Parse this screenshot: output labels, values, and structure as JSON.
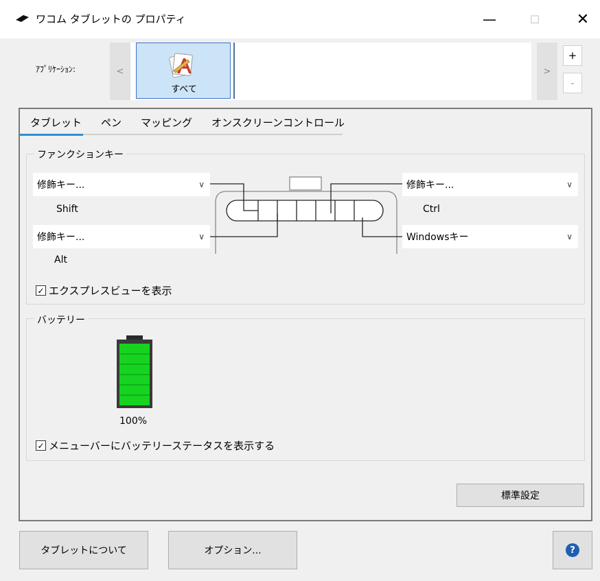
{
  "window": {
    "title": "ワコム タブレットの プロパティ",
    "minimize_glyph": "—",
    "maximize_glyph": "☐",
    "close_glyph": "✕"
  },
  "applications": {
    "label": "ｱﾌﾟﾘｹｰｼｮﾝ:",
    "prev_glyph": "<",
    "next_glyph": ">",
    "items": [
      {
        "label": "すべて",
        "icon": "all-applications-icon",
        "selected": true
      }
    ],
    "add_glyph": "+",
    "remove_glyph": "-"
  },
  "tabs": [
    {
      "label": "タブレット",
      "active": true
    },
    {
      "label": "ペン",
      "active": false
    },
    {
      "label": "マッピング",
      "active": false
    },
    {
      "label": "オンスクリーンコントロール",
      "active": false
    }
  ],
  "function_keys": {
    "title": "ファンクションキー",
    "left_top": {
      "value": "修飾キー...",
      "caption": "Shift"
    },
    "left_bottom": {
      "value": "修飾キー...",
      "caption": "Alt"
    },
    "right_top": {
      "value": "修飾キー...",
      "caption": "Ctrl"
    },
    "right_bottom": {
      "value": "Windowsキー",
      "caption": ""
    },
    "express_view_checkbox": {
      "label": "エクスプレスビューを表示",
      "checked": true
    }
  },
  "battery": {
    "title": "バッテリー",
    "percent_label": "100%",
    "level": 1.0,
    "fill_color": "#16d31f",
    "menubar_checkbox": {
      "label": "メニューバーにバッテリーステータスを表示する",
      "checked": true
    }
  },
  "buttons": {
    "default": "標準設定",
    "about": "タブレットについて",
    "options": "オプション...",
    "help_glyph": "?"
  },
  "colors": {
    "accent": "#2b8fd6",
    "selection": "#cce4f7",
    "selection_border": "#3c73c8"
  }
}
